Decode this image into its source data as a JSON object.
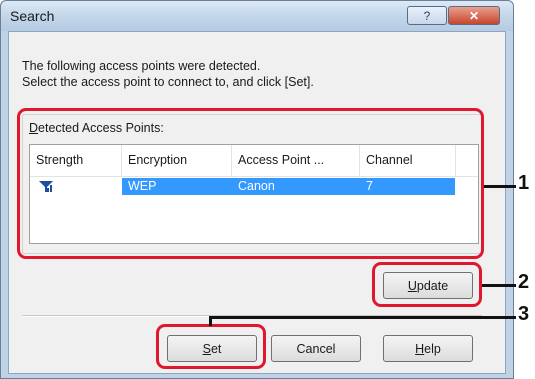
{
  "window": {
    "title": "Search",
    "help_glyph": "?",
    "close_glyph": "✕"
  },
  "description": {
    "line1": "The following access points were detected.",
    "line2": "Select the access point to connect to, and click [Set]."
  },
  "group": {
    "label_prefix": "D",
    "label_rest": "etected Access Points:"
  },
  "table": {
    "columns": [
      "Strength",
      "Encryption",
      "Access Point ...",
      "Channel"
    ],
    "rows": [
      {
        "strength_icon": "signal-strength-icon",
        "encryption": "WEP",
        "access_point": "Canon",
        "channel": "7",
        "selected": true
      }
    ]
  },
  "buttons": {
    "update": {
      "accel": "U",
      "rest": "pdate"
    },
    "set": {
      "accel": "S",
      "rest": "et"
    },
    "cancel": {
      "label": "Cancel"
    },
    "help": {
      "accel": "H",
      "rest": "elp"
    }
  },
  "callouts": [
    "1",
    "2",
    "3"
  ],
  "colors": {
    "highlight": "#e0182d",
    "selection": "#3399ff"
  }
}
